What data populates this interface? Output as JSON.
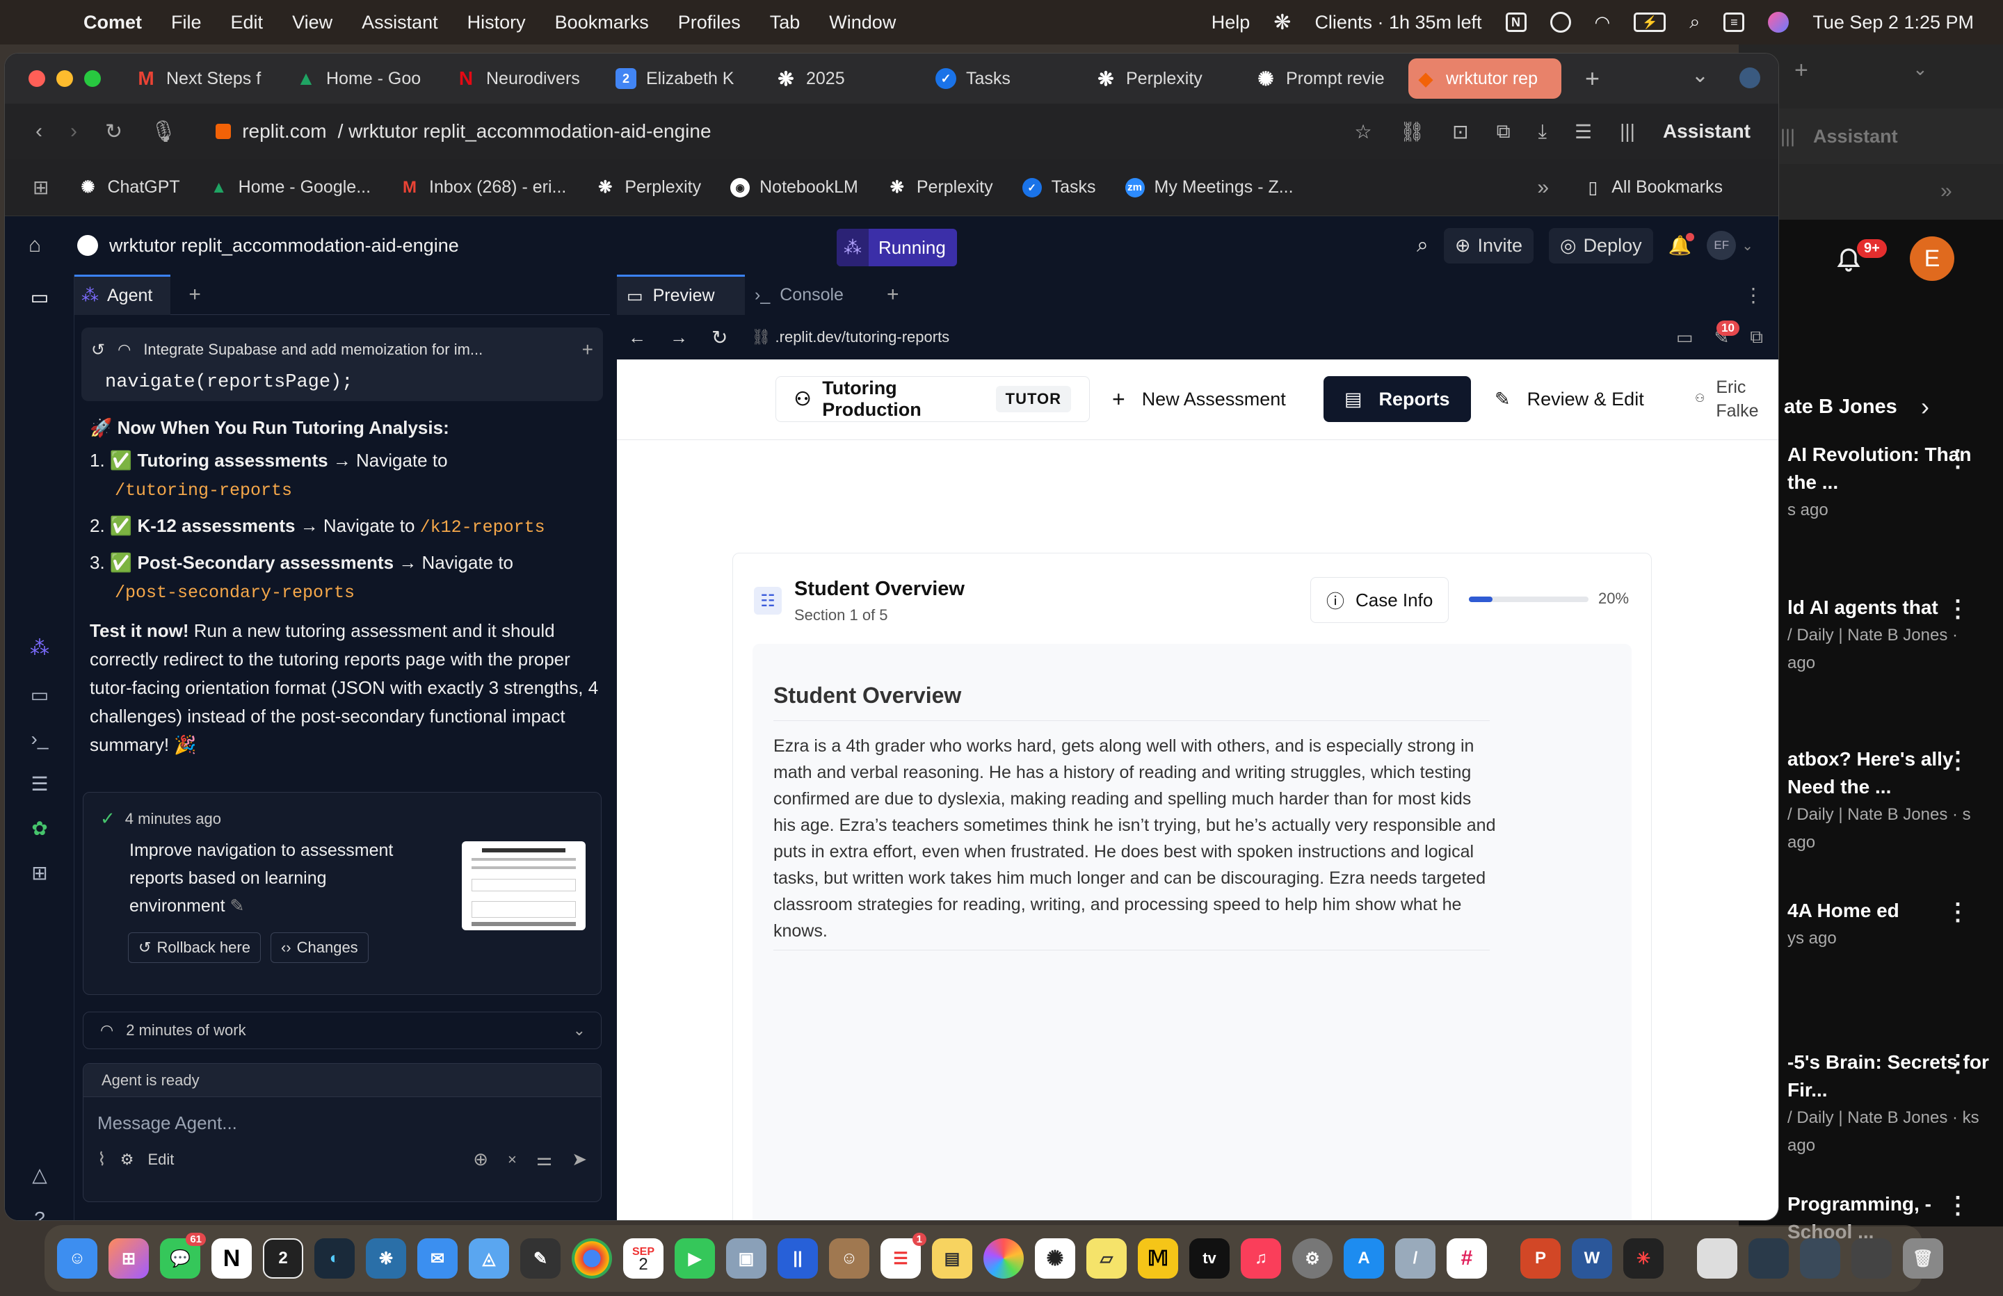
{
  "menubar": {
    "app_name": "Comet",
    "menus": [
      "File",
      "Edit",
      "View",
      "Assistant",
      "History",
      "Bookmarks",
      "Profiles",
      "Tab",
      "Window"
    ],
    "help": "Help",
    "timer": "Clients · 1h 35m left",
    "datetime": "Tue Sep 2  1:25 PM"
  },
  "browser": {
    "tabs": [
      {
        "label": "Next Steps f",
        "icon": "gmail-icon",
        "color": "#ea4335"
      },
      {
        "label": "Home - Goo",
        "icon": "google-drive-icon",
        "color": "#1fa463"
      },
      {
        "label": "Neurodivers",
        "icon": "netflix-icon",
        "color": "#e50914"
      },
      {
        "label": "Elizabeth K",
        "icon": "calendar-icon",
        "color": "#4285f4"
      },
      {
        "label": "2025",
        "icon": "perplexity-icon",
        "color": "#444444"
      },
      {
        "label": "Tasks",
        "icon": "tasks-icon",
        "color": "#1a73e8"
      },
      {
        "label": "Perplexity",
        "icon": "perplexity-icon",
        "color": "#444444"
      },
      {
        "label": "Prompt revie",
        "icon": "openai-icon",
        "color": "#444444"
      },
      {
        "label": "wrktutor rep",
        "icon": "replit-icon",
        "color": "#f26207"
      }
    ],
    "url_domain": "replit.com",
    "url_path": "/ wrktutor replit_accommodation-aid-engine",
    "assistant_label": "Assistant",
    "bookmarks": [
      {
        "label": "ChatGPT",
        "color": "#444444"
      },
      {
        "label": "Home - Google...",
        "color": "#1fa463"
      },
      {
        "label": "Inbox (268) - eri...",
        "color": "#ea4335"
      },
      {
        "label": "Perplexity",
        "color": "#444444"
      },
      {
        "label": "NotebookLM",
        "color": "#444444"
      },
      {
        "label": "Perplexity",
        "color": "#444444"
      },
      {
        "label": "Tasks",
        "color": "#1a73e8"
      },
      {
        "label": "My Meetings - Z...",
        "color": "#2d8cff"
      }
    ],
    "all_bookmarks": "All Bookmarks"
  },
  "replit": {
    "project_name": "wrktutor replit_accommodation-aid-engine",
    "status": "Running",
    "invite": "Invite",
    "deploy": "Deploy",
    "user_initials": "EF",
    "agent_tab": "Agent",
    "checkpoint_title": "Integrate Supabase and add memoization for im...",
    "code_line": "navigate(reportsPage);",
    "heading": "🚀 Now When You Run Tutoring Analysis:",
    "steps": [
      {
        "bold": "✅ Tutoring assessments",
        "arrow": " → Navigate to ",
        "path": "/tutoring-reports"
      },
      {
        "bold": "✅ K-12 assessments",
        "arrow": " → Navigate to ",
        "path": "/k12-reports"
      },
      {
        "bold": "✅ Post-Secondary assessments",
        "arrow": " → Navigate to ",
        "path": "/post-secondary-reports"
      }
    ],
    "test_bold": "Test it now!",
    "test_text": " Run a new tutoring assessment and it should correctly redirect to the tutoring reports page with the proper tutor-facing orientation format (JSON with exactly 3 strengths, 4 challenges) instead of the post-secondary functional impact summary! 🎉",
    "card_time": "4 minutes ago",
    "card_message": "Improve navigation to assessment reports based on learning environment",
    "rollback": "Rollback here",
    "changes": "Changes",
    "work_summary": "2 minutes of work",
    "agent_status": "Agent is ready",
    "message_placeholder": "Message Agent...",
    "edit_label": "Edit",
    "preview_tab": "Preview",
    "console_tab": "Console",
    "preview_url": ".replit.dev/tutoring-reports",
    "console_badge": "10"
  },
  "site": {
    "org_name": "Tutoring Production",
    "org_badge": "TUTOR",
    "nav_new": "New Assessment",
    "nav_reports": "Reports",
    "nav_review": "Review & Edit",
    "user_first": "Eric",
    "user_last": "Falke",
    "section_title": "Student Overview",
    "section_sub": "Section 1 of 5",
    "case_info": "Case Info",
    "progress_pct": "20%",
    "progress_value": 0.2,
    "body_title": "Student Overview",
    "body_text": "Ezra is a 4th grader who works hard, gets along well with others, and is especially strong in math and verbal reasoning. He has a history of reading and writing struggles, which testing confirmed are due to dyslexia, making reading and spelling much harder than for most kids his age. Ezra’s teachers sometimes think he isn’t trying, but he’s actually very responsible and puts in extra effort, even when frustrated. He does best with spoken instructions and logical tasks, but written work takes him much longer and can be discouraging. Ezra needs targeted classroom strategies for reading, writing, and processing speed to help him show what he knows."
  },
  "background_window": {
    "assistant_label": "Assistant",
    "notif_badge": "9+",
    "avatar_letter": "E",
    "channel": "ate B Jones",
    "items": [
      {
        "title": "AI Revolution: Than the ...",
        "meta": "s ago"
      },
      {
        "title": "ld AI agents that",
        "meta": "/ Daily | Nate B Jones · ago"
      },
      {
        "title": "atbox? Here's ally Need the ...",
        "meta": "/ Daily | Nate B Jones · s ago"
      },
      {
        "title": "4A Home ed",
        "meta": "ys ago"
      },
      {
        "title": "-5's Brain: Secrets for Fir...",
        "meta": "/ Daily | Nate B Jones · ks ago"
      },
      {
        "title": "Programming, -School ...",
        "meta": ""
      }
    ]
  },
  "dock": {
    "messages_badge": "61",
    "reminders_badge": "1",
    "calendar_month": "SEP",
    "calendar_day": "2",
    "tv_label": "tv"
  }
}
